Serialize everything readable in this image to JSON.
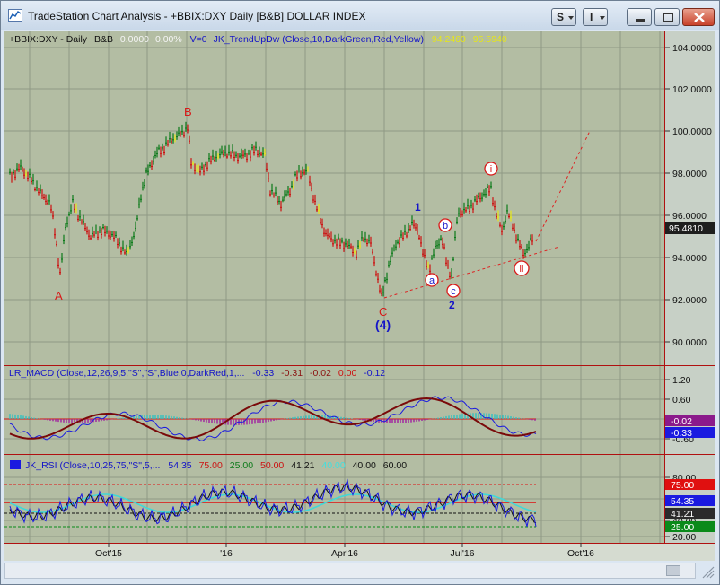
{
  "window": {
    "title": "TradeStation Chart Analysis - +BBIX:DXY Daily [B&B] DOLLAR INDEX",
    "controls": {
      "style_button": "S",
      "data_button": "I"
    }
  },
  "price_panel": {
    "header": {
      "symbol": "+BBIX:DXY - Daily",
      "style": "B&B",
      "change": "0.0000",
      "pct": "0.00%",
      "volume": "V=0",
      "study": "JK_TrendUpDw (Close,10,DarkGreen,Red,Yellow)",
      "val1": "94.2460",
      "val2": "95.5940"
    },
    "y_ticks": [
      "104.0000",
      "102.0000",
      "100.0000",
      "98.0000",
      "96.0000",
      "94.0000",
      "92.0000",
      "90.0000"
    ],
    "last_price": "95.4810",
    "wave_labels": {
      "A": "A",
      "B": "B",
      "C": "C",
      "four": "(4)",
      "one": "1",
      "two": "2",
      "a": "a",
      "b": "b",
      "c": "c",
      "i": "i",
      "ii": "ii"
    }
  },
  "macd_panel": {
    "header": {
      "study": "LR_MACD (Close,12,26,9,5,\"S\",\"S\",Blue,0,DarkRed,1,...",
      "v1": "-0.33",
      "v2": "-0.31",
      "v3": "-0.02",
      "v4": "0.00",
      "v5": "-0.12"
    },
    "y_ticks": [
      "1.20",
      "0.60",
      "0.00",
      "-0.60"
    ],
    "badges": [
      "-0.02",
      "-0.33"
    ]
  },
  "rsi_panel": {
    "header": {
      "study": "JK_RSI (Close,10,25,75,\"S\",5,...",
      "v1": "54.35",
      "v2": "75.00",
      "v3": "25.00",
      "v4": "50.00",
      "v5": "41.21",
      "v6": "40.00",
      "v7": "40.00",
      "v8": "60.00"
    },
    "y_ticks": [
      "80.00",
      "60.00",
      "40.00",
      "20.00"
    ],
    "badges": [
      "75.00",
      "54.35",
      "41.21",
      "25.00"
    ]
  },
  "x_axis": {
    "labels": [
      "Oct'15",
      "'16",
      "Apr'16",
      "Jul'16",
      "Oct'16"
    ]
  },
  "colors": {
    "chart_bg": "#b3bda3",
    "axis_bg": "#c7d0c6",
    "bull": "#0c7a1a",
    "bear": "#cc1111",
    "neutral": "#e6e619",
    "wave_red": "#d81818",
    "wave_blue": "#1414c8"
  }
}
